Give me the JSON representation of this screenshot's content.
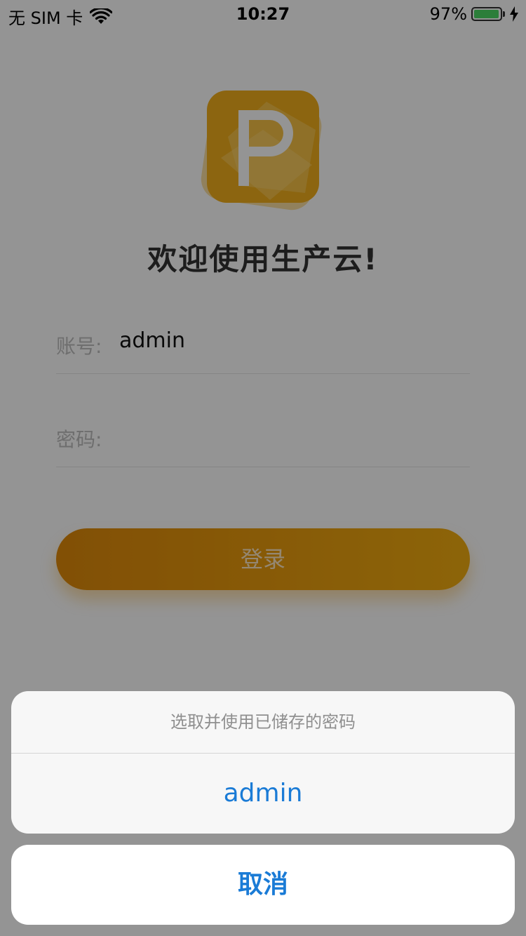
{
  "status_bar": {
    "carrier": "无 SIM 卡",
    "time": "10:27",
    "battery_percent": "97%",
    "battery_level": 0.97,
    "wifi_icon": "wifi-icon",
    "charging_icon": "bolt-icon"
  },
  "logo": {
    "letter": "P",
    "icon": "app-logo",
    "color": "#f2ae1c"
  },
  "welcome": "欢迎使用生产云!",
  "form": {
    "account_label": "账号:",
    "account_value": "admin",
    "password_label": "密码:",
    "password_value": ""
  },
  "login_button": {
    "label": "登录",
    "color_start": "#e08a0a",
    "color_end": "#f2ad10"
  },
  "action_sheet": {
    "title": "选取并使用已储存的密码",
    "options": [
      "admin"
    ],
    "cancel_label": "取消",
    "accent_color": "#1a7bd6"
  }
}
